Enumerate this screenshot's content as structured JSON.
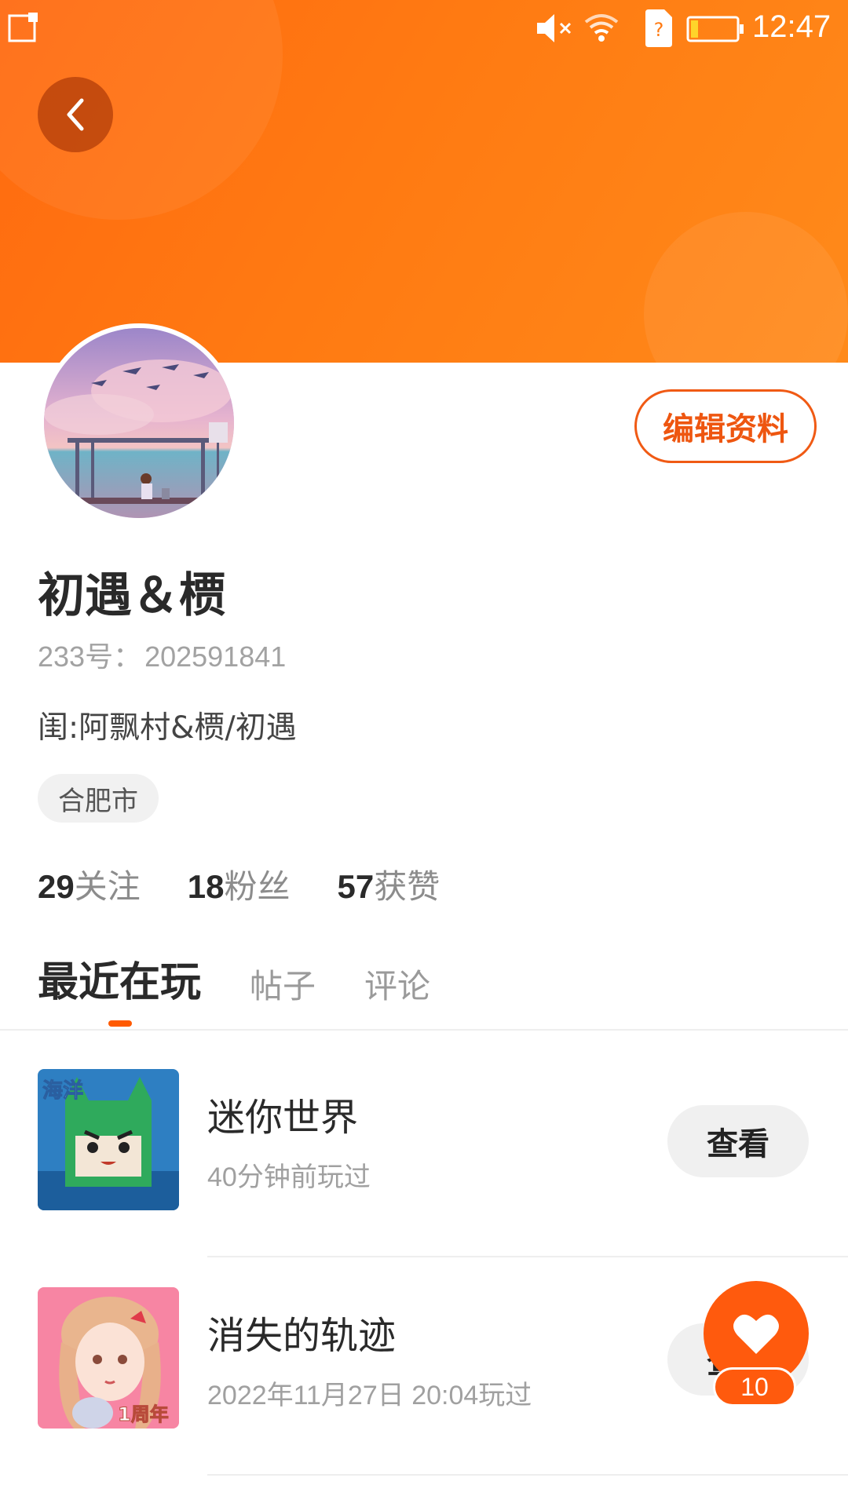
{
  "status_bar": {
    "time": "12:47",
    "icons": [
      "notification-icon",
      "mute-icon",
      "wifi-icon",
      "sim-unknown-icon",
      "battery-low-icon"
    ]
  },
  "header": {
    "back_icon": "chevron-left-icon",
    "banner_color": "#ff7a12",
    "edit_label": "编辑资料"
  },
  "profile": {
    "name": "初遇＆槚",
    "id_label": "233号：",
    "id_value": "202591841",
    "bio": "闺:阿飘村&槚/初遇",
    "location": "合肥市"
  },
  "stats": [
    {
      "num": "29",
      "label": "关注"
    },
    {
      "num": "18",
      "label": "粉丝"
    },
    {
      "num": "57",
      "label": "获赞"
    }
  ],
  "tabs": [
    {
      "label": "最近在玩",
      "active": true
    },
    {
      "label": "帖子",
      "active": false
    },
    {
      "label": "评论",
      "active": false
    }
  ],
  "games": [
    {
      "name": "迷你世界",
      "time": "40分钟前玩过",
      "button": "查看",
      "badge_text": "海洋"
    },
    {
      "name": "消失的轨迹",
      "time": "2022年11月27日 20:04玩过",
      "button": "查看",
      "badge_text": "1周年"
    }
  ],
  "like": {
    "count": "10",
    "icon": "heart-icon",
    "accent": "#ff5a0d"
  }
}
